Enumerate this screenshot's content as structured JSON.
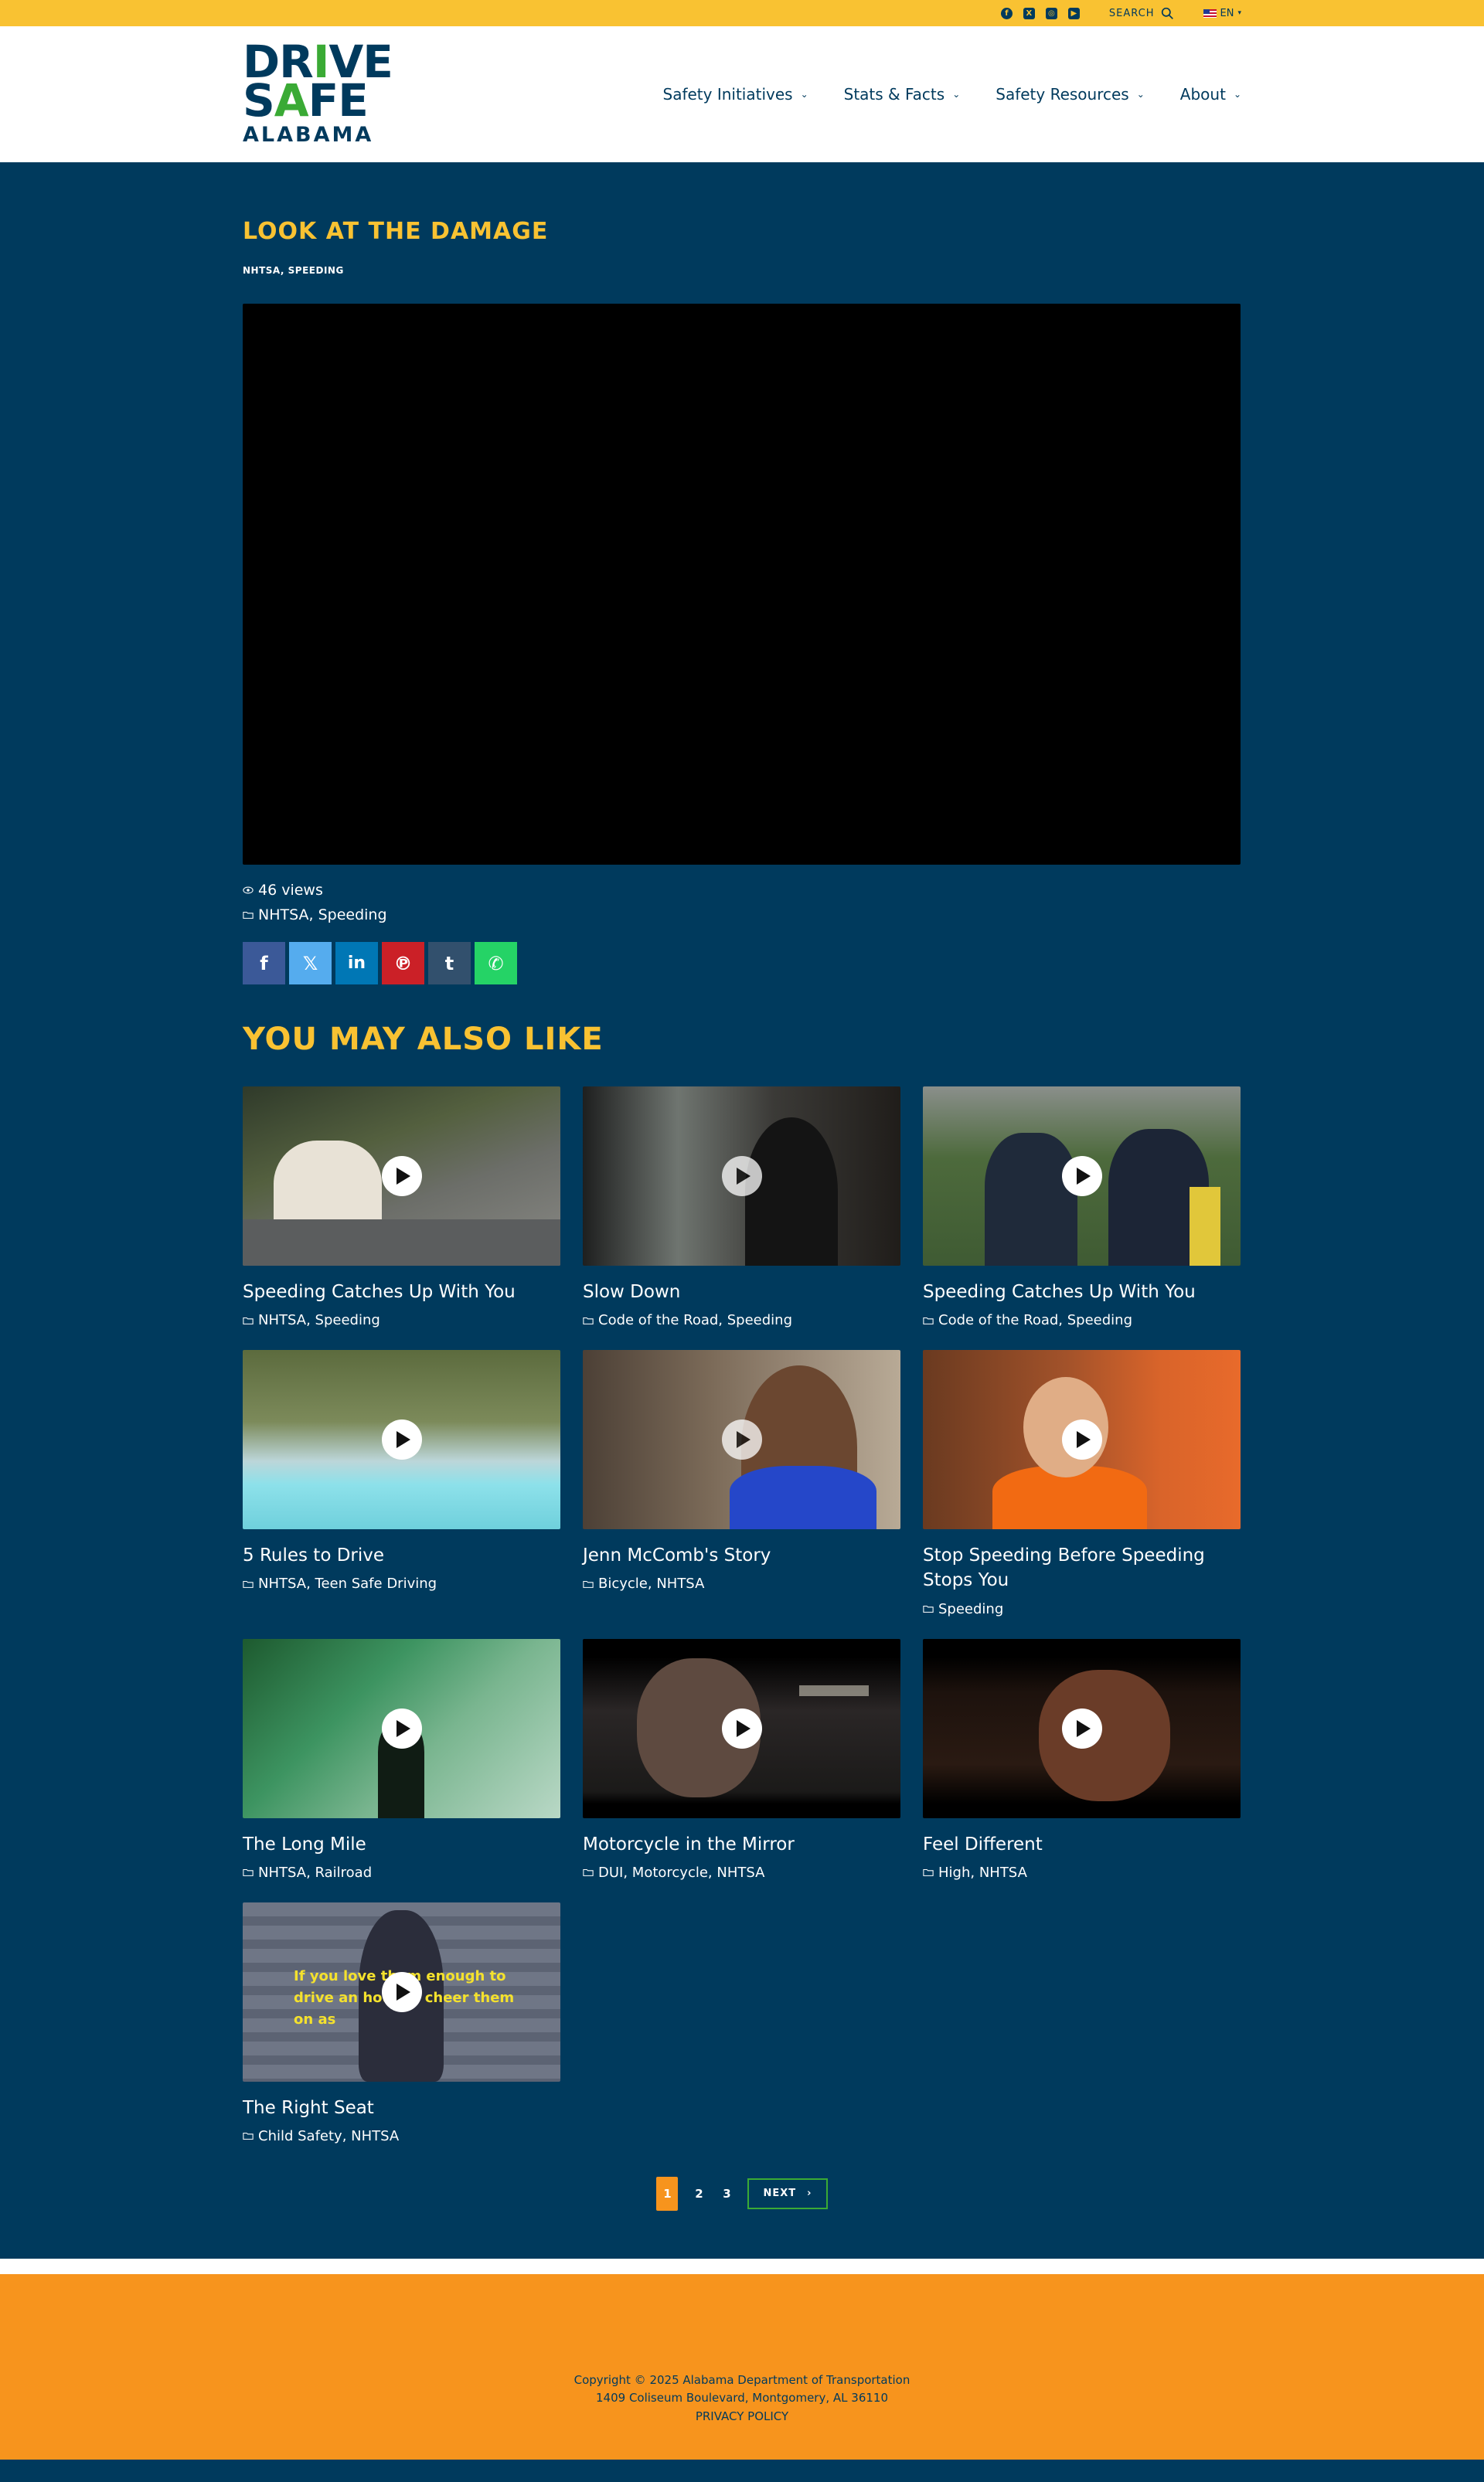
{
  "topbar": {
    "social": [
      {
        "icon": "facebook-icon",
        "glyph": "f"
      },
      {
        "icon": "x-icon",
        "glyph": "X"
      },
      {
        "icon": "instagram-icon",
        "glyph": "◎"
      },
      {
        "icon": "youtube-icon",
        "glyph": "▶"
      }
    ],
    "search_label": "SEARCH",
    "language": "EN"
  },
  "logo": {
    "line1a": "DR",
    "line1b": "I",
    "line1c": "VE",
    "line2a": "S",
    "line2b": "A",
    "line2c": "FE",
    "line3": "ALABAMA"
  },
  "nav": [
    {
      "label": "Safety Initiatives"
    },
    {
      "label": "Stats & Facts"
    },
    {
      "label": "Safety Resources"
    },
    {
      "label": "About"
    }
  ],
  "video": {
    "title": "LOOK AT THE DAMAGE",
    "categories_caps": "NHTSA, SPEEDING",
    "views": "46 views",
    "categories": "NHTSA, Speeding"
  },
  "share": [
    {
      "icon": "facebook-share-icon",
      "glyph": "f",
      "color": "#3b5998"
    },
    {
      "icon": "x-share-icon",
      "glyph": "𝕏",
      "color": "#55acee"
    },
    {
      "icon": "linkedin-share-icon",
      "glyph": "in",
      "color": "#0077b5"
    },
    {
      "icon": "pinterest-share-icon",
      "glyph": "℗",
      "color": "#cb2027"
    },
    {
      "icon": "tumblr-share-icon",
      "glyph": "t",
      "color": "#32506d"
    },
    {
      "icon": "whatsapp-share-icon",
      "glyph": "✆",
      "color": "#25d366"
    }
  ],
  "also_like_title": "YOU MAY ALSO LIKE",
  "related": [
    {
      "title": "Speeding Catches Up With You",
      "cats": "NHTSA, Speeding"
    },
    {
      "title": "Slow Down",
      "cats": "Code of the Road, Speeding"
    },
    {
      "title": "Speeding Catches Up With You",
      "cats": "Code of the Road, Speeding"
    },
    {
      "title": "5 Rules to Drive",
      "cats": "NHTSA, Teen Safe Driving"
    },
    {
      "title": "Jenn McComb's Story",
      "cats": "Bicycle, NHTSA"
    },
    {
      "title": "Stop Speeding Before Speeding Stops You",
      "cats": "Speeding"
    },
    {
      "title": "The Long Mile",
      "cats": "NHTSA, Railroad"
    },
    {
      "title": "Motorcycle in the Mirror",
      "cats": "DUI, Motorcycle, NHTSA"
    },
    {
      "title": "Feel Different",
      "cats": "High, NHTSA"
    },
    {
      "title": "The Right Seat",
      "cats": "Child Safety, NHTSA",
      "overlay": "If you love them enough to drive an hour to cheer them on as"
    }
  ],
  "pagination": {
    "pages": [
      "1",
      "2",
      "3"
    ],
    "next": "NEXT"
  },
  "footer": {
    "copyright": "Copyright © 2025 Alabama Department of Transportation",
    "address": "1409 Coliseum Boulevard, Montgomery, AL 36110",
    "privacy": "PRIVACY POLICY"
  }
}
